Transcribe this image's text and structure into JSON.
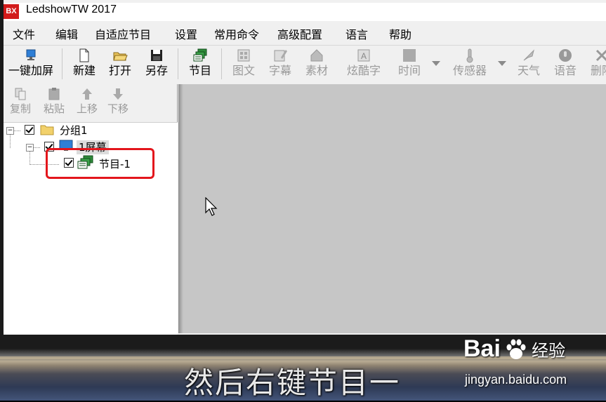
{
  "window": {
    "title": "LedshowTW 2017",
    "logo_text": "BX"
  },
  "menu": [
    "文件",
    "编辑",
    "自适应节目",
    "设置",
    "常用命令",
    "高级配置",
    "语言",
    "帮助"
  ],
  "toolbar": {
    "one_click_screen": "一键加屏",
    "new": "新建",
    "open": "打开",
    "save_as": "另存",
    "program": "节目",
    "image_text": "图文",
    "subtitle": "字幕",
    "material": "素材",
    "cool_text": "炫酷字",
    "time": "时间",
    "sensor": "传感器",
    "weather": "天气",
    "voice": "语音",
    "delete": "删除"
  },
  "left_tools": {
    "copy": "复制",
    "paste": "粘贴",
    "move_up": "上移",
    "move_down": "下移"
  },
  "tree": {
    "group": "分组1",
    "screen": "1屏幕",
    "program": "节目-1"
  },
  "overlay": {
    "subtitle": "然后右键节目一",
    "watermark_brand": "Bai",
    "watermark_brand_suffix": "经验",
    "watermark_url": "jingyan.baidu.com"
  },
  "colors": {
    "highlight": "#e3161c",
    "workspace": "#c6c6c6",
    "logo_red": "#d21b1b"
  }
}
